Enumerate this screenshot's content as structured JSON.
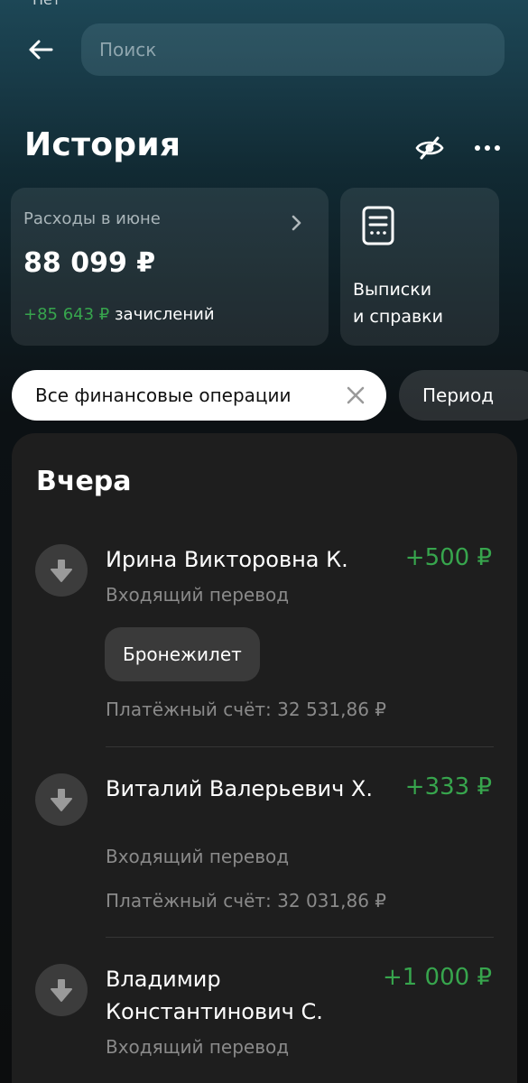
{
  "status_bar": {
    "text": "Нет"
  },
  "search": {
    "placeholder": "Поиск"
  },
  "header": {
    "title": "История"
  },
  "expenses_card": {
    "label": "Расходы в июне",
    "amount": "88 099 ₽",
    "income_amount": "+85 643 ₽",
    "income_label": " зачислений"
  },
  "docs_card": {
    "line1": "Выписки",
    "line2": "и справки"
  },
  "filters": {
    "operations_label": "Все финансовые операции",
    "period_label": "Период"
  },
  "section": {
    "title": "Вчера"
  },
  "operations": [
    {
      "name": "Ирина Викторовна К.",
      "amount": "+500 ₽",
      "type": "Входящий перевод",
      "tag": "Бронежилет",
      "account": "Платёжный счёт: 32 531,86 ₽"
    },
    {
      "name": "Виталий Валерьевич Х.",
      "amount": "+333 ₽",
      "type": "Входящий перевод",
      "account": "Платёжный счёт: 32 031,86 ₽"
    },
    {
      "name": "Владимир Константинович С.",
      "amount": "+1 000 ₽",
      "type": "Входящий перевод"
    }
  ],
  "colors": {
    "income_green": "#37a54d",
    "panel": "#1e1e1e"
  },
  "icons": [
    "arrow-left-icon",
    "eye-off-icon",
    "more-dots-icon",
    "chevron-right-icon",
    "document-icon",
    "close-icon",
    "arrow-down-icon"
  ]
}
